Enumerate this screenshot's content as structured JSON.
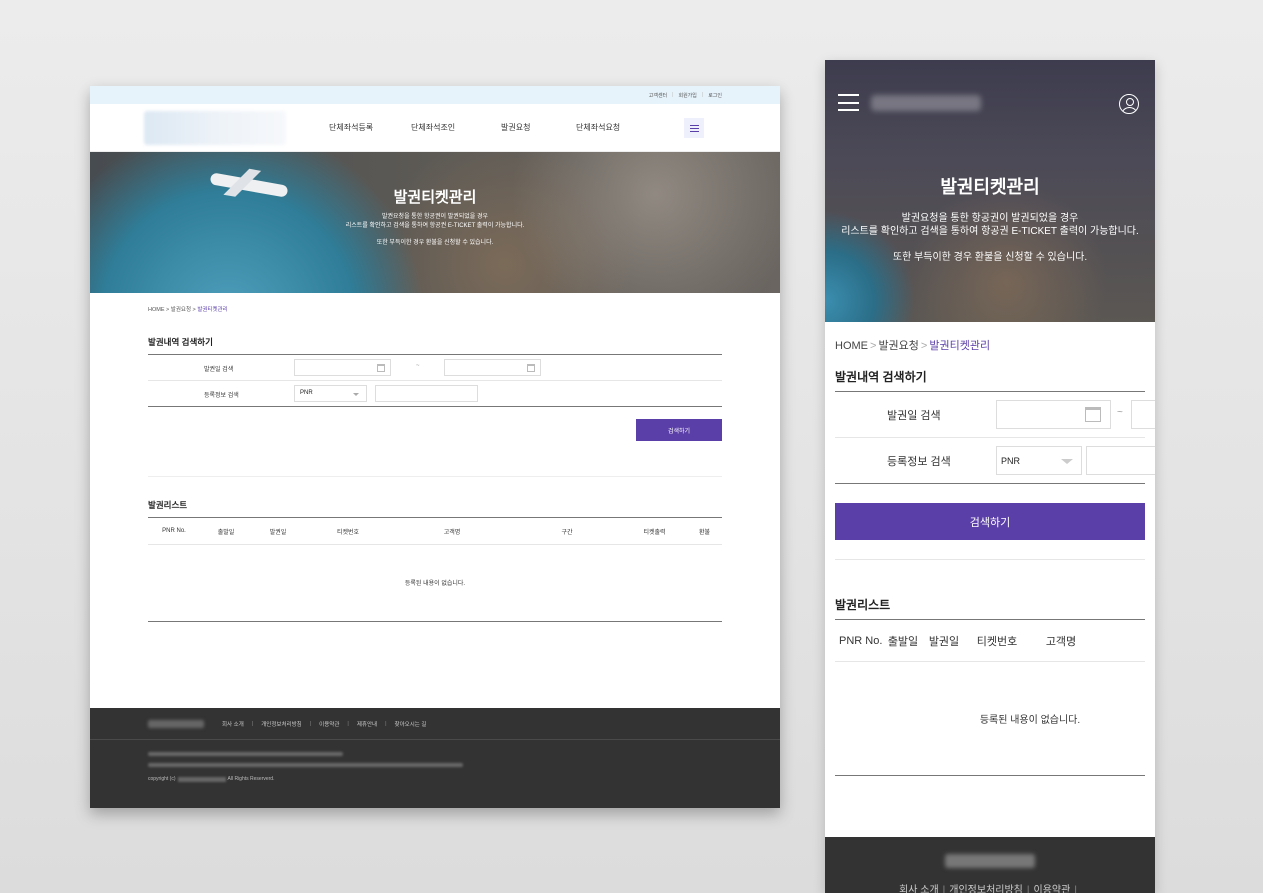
{
  "desktop": {
    "topbar": {
      "links": [
        "고객센터",
        "회원가입",
        "로그인"
      ]
    },
    "nav": [
      "단체좌석등록",
      "단체좌석조인",
      "발권요청",
      "단체좌석요청"
    ],
    "hero": {
      "title": "발권티켓관리",
      "line1": "발권요청을 통한 항공권이 발권되었을 경우",
      "line2": "리스트를 확인하고 검색을 통하여 항공권 E-TICKET 출력이 가능합니다.",
      "line3": "또한 부득이한 경우 환불을 신청할 수 있습니다."
    },
    "breadcrumb": {
      "home": "HOME",
      "parent": "발권요청",
      "current": "발권티켓관리"
    },
    "search": {
      "title": "발권내역 검색하기",
      "date_label": "발권일 검색",
      "date_separator": "~",
      "info_label": "등록정보 검색",
      "select_value": "PNR",
      "button": "검색하기"
    },
    "list": {
      "title": "발권리스트",
      "columns": [
        "PNR No.",
        "출발일",
        "발권일",
        "티켓번호",
        "고객명",
        "구간",
        "티켓출력",
        "환불"
      ],
      "empty": "등록된 내용이 없습니다."
    },
    "footer": {
      "links": [
        "회사 소개",
        "개인정보처리방침",
        "이용약관",
        "제휴안내",
        "찾아오시는 길"
      ],
      "copyright_prefix": "copyright (c)",
      "copyright_suffix": "All Rights Reserverd."
    }
  },
  "mobile": {
    "hero": {
      "title": "발권티켓관리",
      "line1": "발권요청을 통한 항공권이 발권되었을 경우",
      "line2": "리스트를 확인하고 검색을 통하여 항공권 E-TICKET 출력이 가능합니다.",
      "line3": "또한 부득이한 경우 환불을 신청할 수 있습니다."
    },
    "breadcrumb": {
      "home": "HOME",
      "parent": "발권요청",
      "current": "발권티켓관리"
    },
    "search": {
      "title": "발권내역 검색하기",
      "date_label": "발권일 검색",
      "date_separator": "~",
      "info_label": "등록정보 검색",
      "select_value": "PNR",
      "button": "검색하기"
    },
    "list": {
      "title": "발권리스트",
      "columns": [
        "PNR No.",
        "출발일",
        "발권일",
        "티켓번호",
        "고객명"
      ],
      "empty": "등록된 내용이 없습니다."
    },
    "footer": {
      "links": [
        "회사 소개",
        "개인정보처리방침",
        "이용약관"
      ]
    }
  },
  "colors": {
    "accent": "#5b3fa8",
    "topbar_bg": "#e6f3fb",
    "footer_bg": "#333333"
  }
}
